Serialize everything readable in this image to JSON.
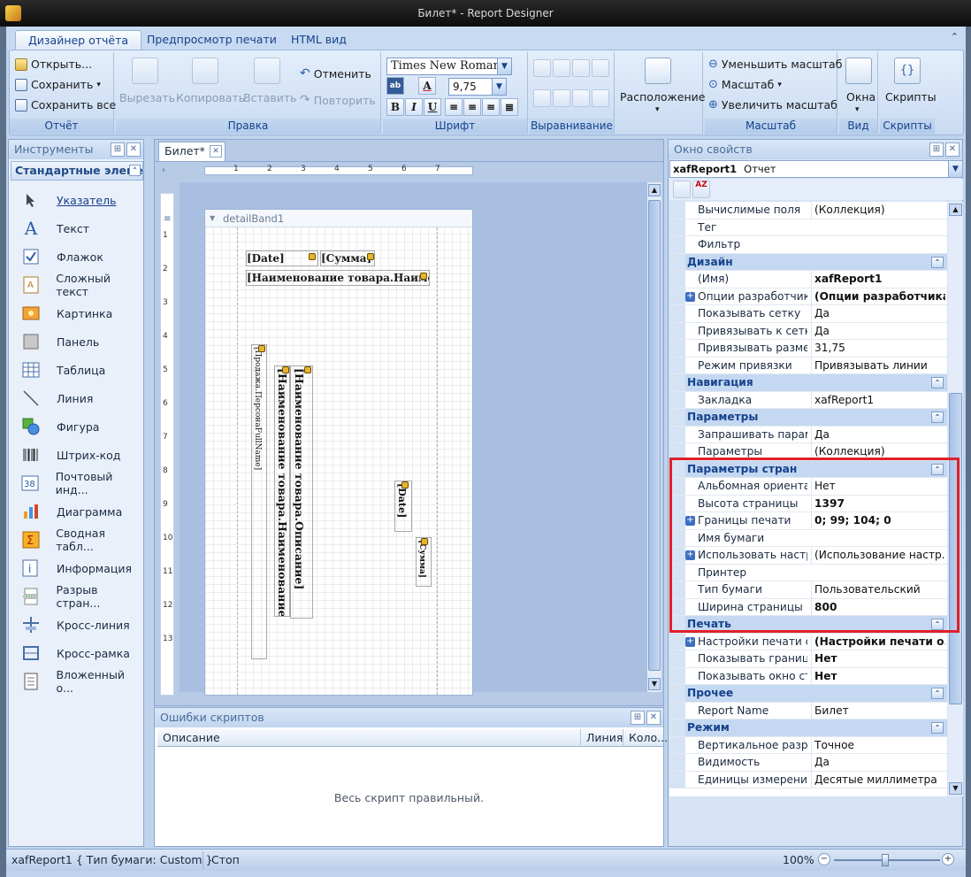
{
  "window": {
    "title": "Билет* - Report Designer"
  },
  "ribbon": {
    "tabs": [
      "Дизайнер отчёта",
      "Предпросмотр печати",
      "HTML вид"
    ],
    "collapse_icon": "chevron-up-icon",
    "groups": {
      "report": {
        "label": "Отчёт",
        "open": "Открыть...",
        "save": "Сохранить",
        "save_all": "Сохранить все"
      },
      "edit": {
        "label": "Правка",
        "cut": "Вырезать",
        "copy": "Копировать",
        "paste": "Вставить",
        "undo": "Отменить",
        "redo": "Повторить"
      },
      "font": {
        "label": "Шрифт",
        "font_name": "Times New Roman",
        "font_size": "9,75",
        "bold": "B",
        "italic": "I",
        "underline": "U",
        "forecolor_letter": "A",
        "backcolor_letter": "ab"
      },
      "align": {
        "label": "Выравнивание"
      },
      "layout": {
        "label": "Расположение"
      },
      "zoom": {
        "label": "Масштаб",
        "zoom_out": "Уменьшить масштаб",
        "zoom": "Масштаб",
        "zoom_in": "Увеличить масштаб"
      },
      "view": {
        "label": "Вид",
        "windows": "Окна"
      },
      "scripts": {
        "label": "Скрипты",
        "scripts": "Скрипты"
      }
    }
  },
  "toolbox": {
    "title": "Инструменты",
    "category": "Стандартные элеме",
    "items": [
      {
        "label": "Указатель",
        "icon": "pointer-icon"
      },
      {
        "label": "Текст",
        "icon": "text-icon"
      },
      {
        "label": "Флажок",
        "icon": "checkbox-icon"
      },
      {
        "label": "Сложный текст",
        "icon": "rich-text-icon"
      },
      {
        "label": "Картинка",
        "icon": "picture-icon"
      },
      {
        "label": "Панель",
        "icon": "panel-icon"
      },
      {
        "label": "Таблица",
        "icon": "table-icon"
      },
      {
        "label": "Линия",
        "icon": "line-icon"
      },
      {
        "label": "Фигура",
        "icon": "shape-icon"
      },
      {
        "label": "Штрих-код",
        "icon": "barcode-icon"
      },
      {
        "label": "Почтовый инд...",
        "icon": "zipcode-icon"
      },
      {
        "label": "Диаграмма",
        "icon": "chart-icon"
      },
      {
        "label": "Сводная табл...",
        "icon": "pivot-icon"
      },
      {
        "label": "Информация",
        "icon": "info-icon"
      },
      {
        "label": "Разрыв стран...",
        "icon": "page-break-icon"
      },
      {
        "label": "Кросс-линия",
        "icon": "cross-line-icon"
      },
      {
        "label": "Кросс-рамка",
        "icon": "cross-band-icon"
      },
      {
        "label": "Вложенный о...",
        "icon": "subreport-icon"
      }
    ]
  },
  "designer": {
    "tab": "Билет*",
    "band": "detailBand1",
    "ruler_marks": [
      "1",
      "2",
      "3",
      "4",
      "5",
      "6",
      "7"
    ],
    "vruler_marks": [
      "1",
      "2",
      "3",
      "4",
      "5",
      "6",
      "7",
      "8",
      "9",
      "10",
      "11",
      "12",
      "13"
    ],
    "fields": {
      "date": "[Date]",
      "sum": "[Сумма]",
      "name": "[Наименование товара.Наименование]",
      "v_sale": "[Продажа.ПерсонаFullName]",
      "v_name": "[Наименование товара.Наименование]",
      "v_desc": "[Наименование товара.Описание]",
      "v_date": "[Date]",
      "v_sum": "[Сумма]"
    }
  },
  "errors": {
    "title": "Ошибки скриптов",
    "columns": [
      "Описание",
      "Линия",
      "Коло..."
    ],
    "message": "Весь скрипт правильный."
  },
  "properties": {
    "title": "Окно свойств",
    "object_name": "xafReport1",
    "object_type": "Отчет",
    "rows": [
      {
        "type": "prop",
        "name": "Вычислимые поля",
        "value": "(Коллекция)"
      },
      {
        "type": "prop",
        "name": "Тег",
        "value": ""
      },
      {
        "type": "prop",
        "name": "Фильтр",
        "value": ""
      },
      {
        "type": "cat",
        "name": "Дизайн"
      },
      {
        "type": "prop",
        "name": "(Имя)",
        "value": "xafReport1",
        "bold": true
      },
      {
        "type": "prop",
        "name": "Опции разработчика",
        "value": "(Опции разработчика)",
        "bold": true,
        "expand": true
      },
      {
        "type": "prop",
        "name": "Показывать сетку",
        "value": "Да"
      },
      {
        "type": "prop",
        "name": "Привязывать к сетке",
        "value": "Да"
      },
      {
        "type": "prop",
        "name": "Привязывать размер",
        "value": "31,75"
      },
      {
        "type": "prop",
        "name": "Режим привязки",
        "value": "Привязывать линии"
      },
      {
        "type": "cat",
        "name": "Навигация"
      },
      {
        "type": "prop",
        "name": "Закладка",
        "value": "xafReport1"
      },
      {
        "type": "cat",
        "name": "Параметры"
      },
      {
        "type": "prop",
        "name": "Запрашивать параме",
        "value": "Да"
      },
      {
        "type": "prop",
        "name": "Параметры",
        "value": "(Коллекция)"
      },
      {
        "type": "cat",
        "name": "Параметры страницы"
      },
      {
        "type": "prop",
        "name": "Альбомная ориентац",
        "value": "Нет"
      },
      {
        "type": "prop",
        "name": "Высота страницы",
        "value": "1397",
        "bold": true
      },
      {
        "type": "prop",
        "name": "Границы печати",
        "value": "0; 99; 104; 0",
        "bold": true,
        "expand": true
      },
      {
        "type": "prop",
        "name": "Имя бумаги",
        "value": ""
      },
      {
        "type": "prop",
        "name": "Использовать настро",
        "value": "(Использование настр...",
        "expand": true
      },
      {
        "type": "prop",
        "name": "Принтер",
        "value": ""
      },
      {
        "type": "prop",
        "name": "Тип бумаги",
        "value": "Пользовательский"
      },
      {
        "type": "prop",
        "name": "Ширина страницы",
        "value": "800",
        "bold": true
      },
      {
        "type": "cat",
        "name": "Печать"
      },
      {
        "type": "prop",
        "name": "Настройки печати от",
        "value": "(Настройки печати о...",
        "bold": true,
        "expand": true
      },
      {
        "type": "prop",
        "name": "Показывать границы",
        "value": "Нет",
        "bold": true
      },
      {
        "type": "prop",
        "name": "Показывать окно ста",
        "value": "Нет",
        "bold": true
      },
      {
        "type": "cat",
        "name": "Прочее"
      },
      {
        "type": "prop",
        "name": "Report Name",
        "value": "Билет"
      },
      {
        "type": "cat",
        "name": "Режим"
      },
      {
        "type": "prop",
        "name": "Вертикальное разре",
        "value": "Точное"
      },
      {
        "type": "prop",
        "name": "Видимость",
        "value": "Да"
      },
      {
        "type": "prop",
        "name": "Единицы измерения",
        "value": "Десятые миллиметра"
      }
    ]
  },
  "status": {
    "left": "xafReport1 { Тип бумаги: Custom }",
    "state": "Стоп",
    "zoom": "100%"
  }
}
